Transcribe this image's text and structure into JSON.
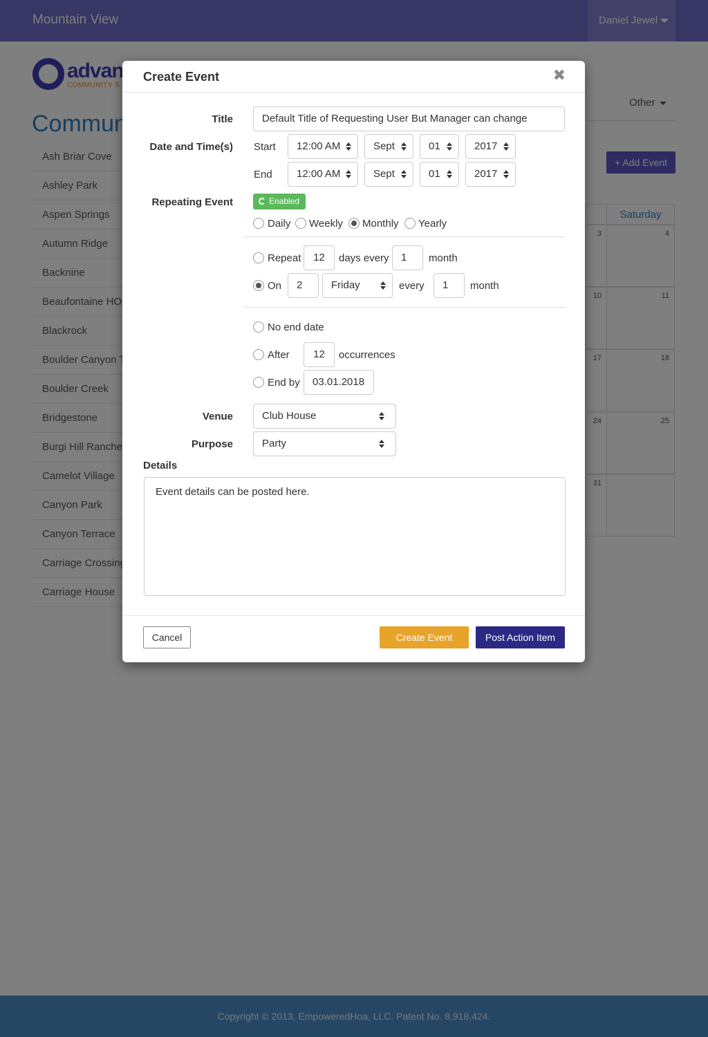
{
  "navbar": {
    "brand": "Mountain View",
    "user_name": "Daniel Jewel"
  },
  "logo": {
    "text": "advan",
    "subtext": "COMMUNITY S"
  },
  "page_title": "Communi",
  "communities": [
    "Ash Briar Cove",
    "Ashley Park",
    "Aspen Springs",
    "Autumn Ridge",
    "Backnine",
    "Beaufontaine HOA",
    "Blackrock",
    "Boulder Canyon Te",
    "Boulder Creek",
    "Bridgestone",
    "Burgi Hill Ranches",
    "Camelot Village",
    "Canyon Park",
    "Canyon Terrace",
    "Carriage Crossing",
    "Carriage House"
  ],
  "right_panel": {
    "other_label": "Other",
    "add_event_label": "+ Add Event",
    "calendar": {
      "headers": [
        "",
        "Saturday"
      ],
      "rows": [
        [
          "3",
          "4"
        ],
        [
          "10",
          "11"
        ],
        [
          "17",
          "18"
        ],
        [
          "24",
          "25"
        ],
        [
          "31",
          ""
        ]
      ]
    }
  },
  "modal": {
    "title": "Create Event",
    "close_icon": "close-icon",
    "labels": {
      "title": "Title",
      "date_time": "Date and Time(s)",
      "repeating": "Repeating Event",
      "venue": "Venue",
      "purpose": "Purpose",
      "details": "Details"
    },
    "title_value": "Default Title of Requesting User But Manager can change",
    "start": {
      "label": "Start",
      "time": "12:00 AM",
      "month": "Sept",
      "day": "01",
      "year": "2017"
    },
    "end": {
      "label": "End",
      "time": "12:00 AM",
      "month": "Sept",
      "day": "01",
      "year": "2017"
    },
    "repeating_badge": "Enabled",
    "frequency": {
      "options": [
        "Daily",
        "Weekly",
        "Monthly",
        "Yearly"
      ],
      "selected": "Monthly"
    },
    "repeat_days": {
      "label": "Repeat",
      "days_value": "12",
      "days_every_text": "days every",
      "every_value": "1",
      "unit": "month",
      "selected": false
    },
    "repeat_on": {
      "label": "On",
      "ordinal": "2",
      "weekday": "Friday",
      "every_text": "every",
      "every_value": "1",
      "unit": "month",
      "selected": true
    },
    "end_options": {
      "no_end": "No end date",
      "after_label": "After",
      "after_value": "12",
      "occurrences": "occurrences",
      "end_by_label": "End by",
      "end_by_value": "03.01.2018"
    },
    "venue": "Club House",
    "purpose": "Party",
    "details_text": "Event details can be posted here.",
    "buttons": {
      "cancel": "Cancel",
      "create": "Create Event",
      "post": "Post Action Item"
    }
  },
  "footer": {
    "copyright": "Copyright © 2013, EmpoweredHoa, LLC. Patent No. 8,918,424."
  },
  "colors": {
    "navbar": "#6f6cc8",
    "accent_blue": "#2e7fc3",
    "create_button": "#e8a32a",
    "post_button": "#2a2a85",
    "enabled_badge": "#5cb85c",
    "footer": "#4a8fc9"
  }
}
